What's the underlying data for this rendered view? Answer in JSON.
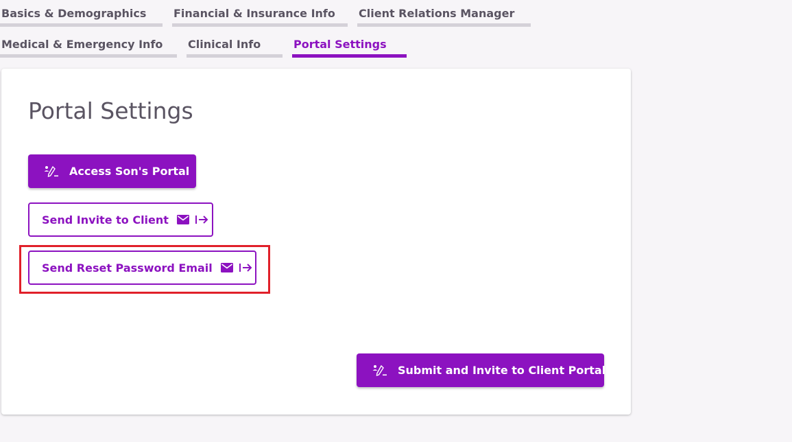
{
  "tabs": [
    {
      "label": "Basics & Demographics",
      "active": false
    },
    {
      "label": "Financial & Insurance Info",
      "active": false
    },
    {
      "label": "Client Relations Manager",
      "active": false
    },
    {
      "label": "Medical & Emergency Info",
      "active": false
    },
    {
      "label": "Clinical Info",
      "active": false
    },
    {
      "label": "Portal Settings",
      "active": true
    }
  ],
  "card": {
    "title": "Portal Settings",
    "access_portal_label": "Access Son's Portal",
    "send_invite_label": "Send Invite to Client",
    "send_reset_label": "Send Reset Password Email",
    "submit_label": "Submit and Invite to Client Portal"
  },
  "colors": {
    "accent": "#8c12c0",
    "tab_inactive": "#d4d1d8",
    "highlight": "#e0202a",
    "text": "#5a5462"
  },
  "icons": {
    "access_portal": "user-edit-icon",
    "invite_mail": "mail-icon",
    "invite_arrow": "arrow-right-to-line-icon",
    "reset_mail": "mail-icon",
    "reset_arrow": "arrow-right-to-line-icon",
    "submit": "user-edit-icon"
  }
}
